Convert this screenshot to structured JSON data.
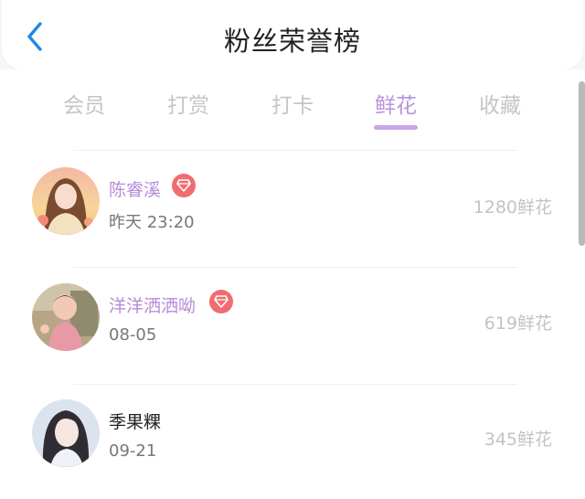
{
  "header": {
    "title": "粉丝荣誉榜",
    "back_icon": "chevron-left-icon",
    "accent": "#1e88e5"
  },
  "tabs": [
    {
      "label": "会员",
      "active": false
    },
    {
      "label": "打赏",
      "active": false
    },
    {
      "label": "打卡",
      "active": false
    },
    {
      "label": "鲜花",
      "active": true
    },
    {
      "label": "收藏",
      "active": false
    }
  ],
  "active_color": "#b993db",
  "fans": [
    {
      "name": "陈睿溪",
      "time": "昨天 23:20",
      "amount": "1280鲜花",
      "vip": true,
      "badge_icon": "diamond-icon"
    },
    {
      "name": "洋洋洒洒呦",
      "time": "08-05",
      "amount": "619鲜花",
      "vip": true,
      "badge_icon": "diamond-icon"
    },
    {
      "name": "季果粿",
      "time": "09-21",
      "amount": "345鲜花",
      "vip": false
    }
  ]
}
